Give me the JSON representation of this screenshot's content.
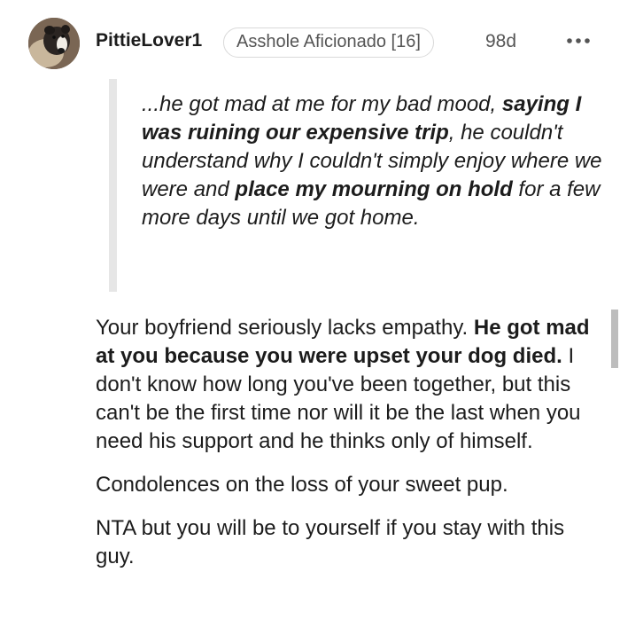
{
  "comment": {
    "author": "PittieLover1",
    "flair": "Asshole Aficionado [16]",
    "age": "98d",
    "more_icon": "more-horizontal-icon",
    "quote": {
      "part1": "...he got mad at me for my bad mood, ",
      "bold1": "saying I was ruining our expensive trip",
      "part2": ", he couldn't understand why I couldn't simply enjoy where we were and ",
      "bold2": "place my mourning on hold",
      "part3": " for a few more days until we got home."
    },
    "paragraphs": [
      {
        "text1": "Your boyfriend seriously lacks empathy. ",
        "bold": "He got mad at you because you were upset your dog died.",
        "text2": " I don't know how long you've been together, but this can't be the first time nor will it be the last when you need his support and he thinks only of himself."
      },
      {
        "text": "Condolences on the loss of your sweet pup."
      },
      {
        "text": "NTA but you will be to yourself if you stay with this guy."
      }
    ]
  },
  "colors": {
    "text": "#1c1c1c",
    "muted": "#555555",
    "quote_bar": "#e6e6e6",
    "flair_border": "#d9d9d9"
  }
}
